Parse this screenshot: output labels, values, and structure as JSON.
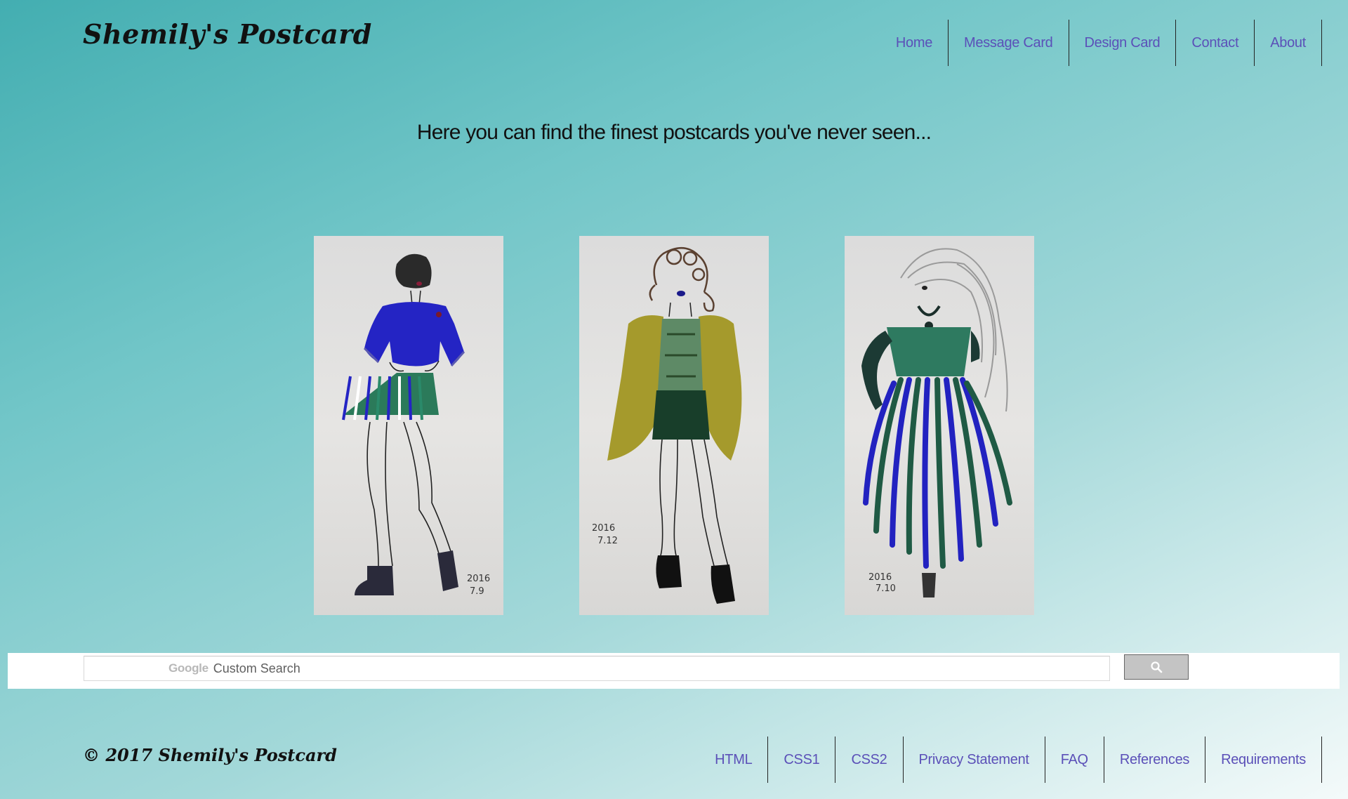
{
  "header": {
    "brand": "Shemily's Postcard",
    "nav": [
      {
        "label": "Home"
      },
      {
        "label": "Message Card"
      },
      {
        "label": "Design Card"
      },
      {
        "label": "Contact"
      },
      {
        "label": "About"
      }
    ]
  },
  "main": {
    "tagline": "Here you can find the finest postcards you've never seen...",
    "postcards": [
      {
        "name": "blue-top-striped-skirt-sketch",
        "signature": "2016 7.9"
      },
      {
        "name": "olive-vest-green-skirt-sketch",
        "signature": "2016 7.12"
      },
      {
        "name": "green-blue-gown-sketch",
        "signature": "2016 7.10"
      }
    ]
  },
  "search": {
    "brand_mark": "Google",
    "placeholder": "Custom Search",
    "button_icon": "search-icon"
  },
  "footer": {
    "copyright": "© 2017 Shemily's Postcard",
    "links": [
      {
        "label": "HTML"
      },
      {
        "label": "CSS1"
      },
      {
        "label": "CSS2"
      },
      {
        "label": "Privacy Statement"
      },
      {
        "label": "FAQ"
      },
      {
        "label": "References"
      },
      {
        "label": "Requirements"
      }
    ]
  },
  "colors": {
    "nav_link": "#5b50b8",
    "gradient_start": "#43aeb1",
    "gradient_end": "#f4fafa"
  }
}
